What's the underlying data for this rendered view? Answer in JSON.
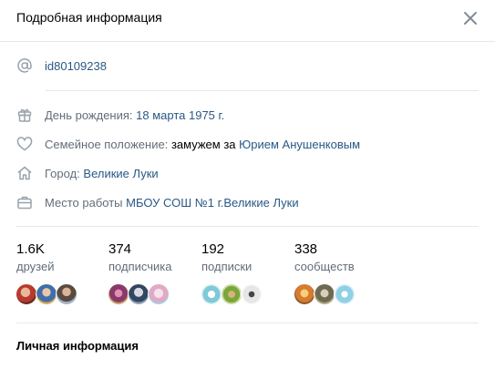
{
  "header": {
    "title": "Подробная информация",
    "close_icon": "close-icon"
  },
  "id_row": {
    "icon": "at-icon",
    "value": "id80109238"
  },
  "info": {
    "birthday": {
      "icon": "gift-icon",
      "label": "День рождения:",
      "value": "18 марта 1975 г."
    },
    "family": {
      "icon": "heart-icon",
      "label": "Семейное положение:",
      "text": "замужем за",
      "value": "Юрием Анушенковым"
    },
    "city": {
      "icon": "home-icon",
      "label": "Город:",
      "value": "Великие Луки"
    },
    "work": {
      "icon": "briefcase-icon",
      "label": "Место работы",
      "value": "МБОУ СОШ №1 г.Великие Луки"
    }
  },
  "stats": [
    {
      "count": "1.6K",
      "caption": "друзей"
    },
    {
      "count": "374",
      "caption": "подписчика"
    },
    {
      "count": "192",
      "caption": "подписки"
    },
    {
      "count": "338",
      "caption": "сообществ"
    }
  ],
  "section": {
    "title": "Личная информация"
  },
  "colors": {
    "link": "#2a5885",
    "label": "#626d7a",
    "divider": "#e7e8ec",
    "icon": "#99a2ad"
  }
}
